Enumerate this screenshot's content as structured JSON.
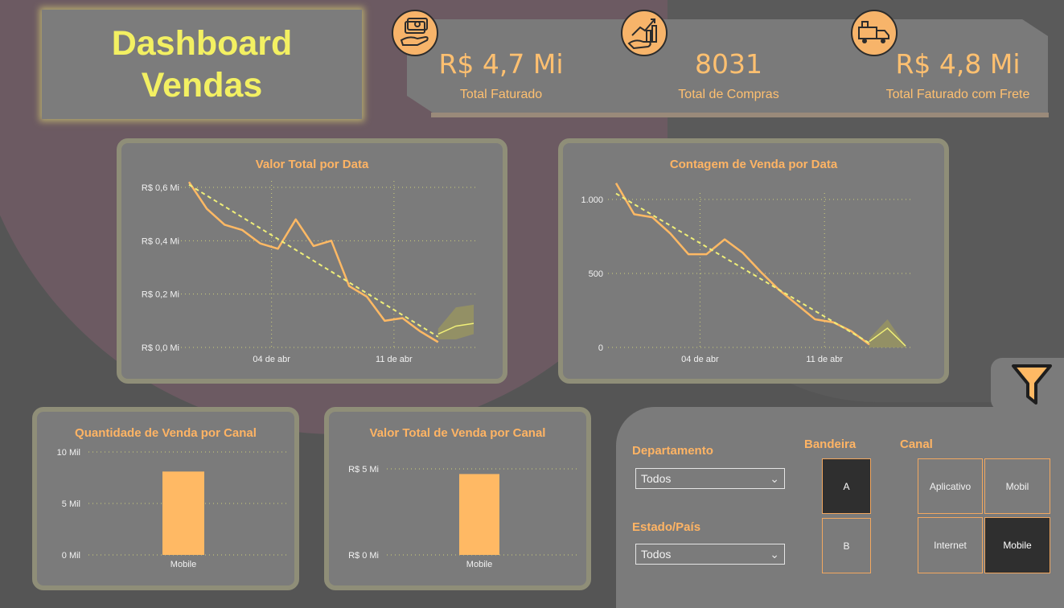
{
  "header": {
    "title_line1": "Dashboard",
    "title_line2": "Vendas"
  },
  "kpis": [
    {
      "value": "R$ 4,7 Mi",
      "label": "Total Faturado",
      "icon": "money-hand-icon"
    },
    {
      "value": "8031",
      "label": "Total de Compras",
      "icon": "growth-hand-icon"
    },
    {
      "value": "R$ 4,8 Mi",
      "label": "Total Faturado com Frete",
      "icon": "delivery-truck-icon"
    }
  ],
  "colors": {
    "accent": "#ffb464",
    "title": "#f3f062",
    "trend": "#f0ef78",
    "bar": "#ffb964",
    "selected": "#2f2f2f"
  },
  "chart_data": [
    {
      "type": "line",
      "title": "Valor Total por Data",
      "x_ticks": [
        "04 de abr",
        "11 de abr"
      ],
      "y_ticks": [
        "R$ 0,0 Mi",
        "R$ 0,2 Mi",
        "R$ 0,4 Mi",
        "R$ 0,6 Mi"
      ],
      "ylim": [
        0,
        0.6
      ],
      "series": [
        {
          "values": [
            0.62,
            0.52,
            0.46,
            0.44,
            0.39,
            0.37,
            0.48,
            0.38,
            0.4,
            0.23,
            0.19,
            0.1,
            0.11,
            0.06,
            0.02
          ]
        },
        {
          "values": [
            null,
            null,
            null,
            null,
            null,
            null,
            null,
            null,
            null,
            null,
            null,
            null,
            null,
            null,
            0.05,
            0.08,
            0.09
          ]
        }
      ],
      "trend": [
        0.61,
        0.04
      ],
      "forecast_band": {
        "upper": [
          0.07,
          0.15,
          0.16
        ],
        "lower": [
          0.03,
          0.03,
          0.05
        ]
      },
      "grid": true
    },
    {
      "type": "line",
      "title": "Contagem de Venda por Data",
      "x_ticks": [
        "04 de abr",
        "11 de abr"
      ],
      "y_ticks": [
        "0",
        "500",
        "1.000"
      ],
      "ylim": [
        0,
        1000
      ],
      "series": [
        {
          "values": [
            1110,
            900,
            880,
            770,
            630,
            630,
            730,
            640,
            510,
            390,
            290,
            190,
            170,
            110,
            20
          ]
        },
        {
          "values": [
            null,
            null,
            null,
            null,
            null,
            null,
            null,
            null,
            null,
            null,
            null,
            null,
            null,
            null,
            40,
            130,
            10
          ]
        }
      ],
      "trend": [
        1040,
        30
      ],
      "forecast_band": {
        "upper": [
          60,
          190,
          10
        ],
        "lower": [
          0,
          0,
          0
        ]
      },
      "grid": true
    },
    {
      "type": "bar",
      "title": "Quantidade de Venda por Canal",
      "categories": [
        "Mobile"
      ],
      "values": [
        8.1
      ],
      "y_ticks": [
        "0 Mil",
        "5 Mil",
        "10 Mil"
      ],
      "ylim": [
        0,
        10
      ]
    },
    {
      "type": "bar",
      "title": "Valor Total de Venda por Canal",
      "categories": [
        "Mobile"
      ],
      "values": [
        4.7
      ],
      "y_ticks": [
        "R$ 0 Mi",
        "R$ 5 Mi"
      ],
      "ylim": [
        0,
        5
      ]
    }
  ],
  "filters": {
    "departamento": {
      "label": "Departamento",
      "value": "Todos"
    },
    "estado": {
      "label": "Estado/País",
      "value": "Todos"
    },
    "bandeira": {
      "label": "Bandeira",
      "options": [
        "A",
        "B"
      ],
      "selected": "A"
    },
    "canal": {
      "label": "Canal",
      "options": [
        "Aplicativo",
        "Mobil",
        "Internet",
        "Mobile"
      ],
      "selected": "Mobile"
    }
  }
}
